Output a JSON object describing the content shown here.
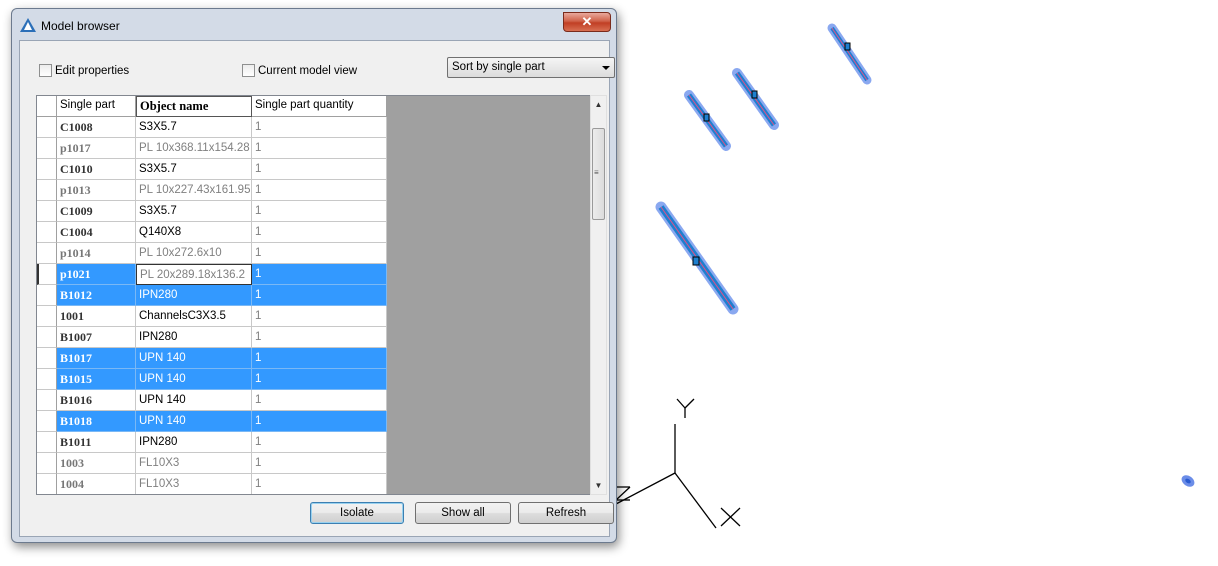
{
  "window": {
    "title": "Model browser",
    "close_label": "✕"
  },
  "options": {
    "edit_properties": {
      "label": "Edit properties",
      "checked": false
    },
    "current_model_view": {
      "label": "Current model view",
      "checked": false
    },
    "sort": {
      "selected": "Sort by single part"
    }
  },
  "table": {
    "columns": [
      "Single part",
      "Object name",
      "Single part quantity"
    ],
    "rows": [
      {
        "part": "C1008",
        "name": "S3X5.7",
        "qty": "1",
        "selected": false,
        "name_gray": false
      },
      {
        "part": "p1017",
        "name": "PL 10x368.11x154.28",
        "qty": "1",
        "selected": false,
        "name_gray": true
      },
      {
        "part": "C1010",
        "name": "S3X5.7",
        "qty": "1",
        "selected": false,
        "name_gray": false
      },
      {
        "part": "p1013",
        "name": "PL 10x227.43x161.95",
        "qty": "1",
        "selected": false,
        "name_gray": true
      },
      {
        "part": "C1009",
        "name": "S3X5.7",
        "qty": "1",
        "selected": false,
        "name_gray": false
      },
      {
        "part": "C1004",
        "name": "Q140X8",
        "qty": "1",
        "selected": false,
        "name_gray": false
      },
      {
        "part": "p1014",
        "name": "PL 10x272.6x10",
        "qty": "1",
        "selected": false,
        "name_gray": true
      },
      {
        "part": "p1021",
        "name": "PL 20x289.18x136.2",
        "qty": "1",
        "selected": true,
        "editing": true,
        "name_gray": true
      },
      {
        "part": "B1012",
        "name": "IPN280",
        "qty": "1",
        "selected": true,
        "name_gray": false
      },
      {
        "part": "1001",
        "name": "ChannelsC3X3.5",
        "qty": "1",
        "selected": false,
        "name_gray": false
      },
      {
        "part": "B1007",
        "name": "IPN280",
        "qty": "1",
        "selected": false,
        "name_gray": false
      },
      {
        "part": "B1017",
        "name": "UPN 140",
        "qty": "1",
        "selected": true,
        "name_gray": false
      },
      {
        "part": "B1015",
        "name": "UPN 140",
        "qty": "1",
        "selected": true,
        "name_gray": false
      },
      {
        "part": "B1016",
        "name": "UPN 140",
        "qty": "1",
        "selected": false,
        "name_gray": false
      },
      {
        "part": "B1018",
        "name": "UPN 140",
        "qty": "1",
        "selected": true,
        "name_gray": false
      },
      {
        "part": "B1011",
        "name": "IPN280",
        "qty": "1",
        "selected": false,
        "name_gray": false
      },
      {
        "part": "1003",
        "name": "FL10X3",
        "qty": "1",
        "selected": false,
        "name_gray": true
      },
      {
        "part": "1004",
        "name": "FL10X3",
        "qty": "1",
        "selected": false,
        "name_gray": true
      }
    ]
  },
  "buttons": {
    "isolate": "Isolate",
    "show_all": "Show all",
    "refresh": "Refresh"
  },
  "viewport": {
    "axis_y": "Y",
    "axis_x": "X",
    "axis_z": "Z"
  },
  "colors": {
    "selection": "#3399ff",
    "highlight_member": "#6b8de8",
    "member_core": "#1e7fcf"
  }
}
